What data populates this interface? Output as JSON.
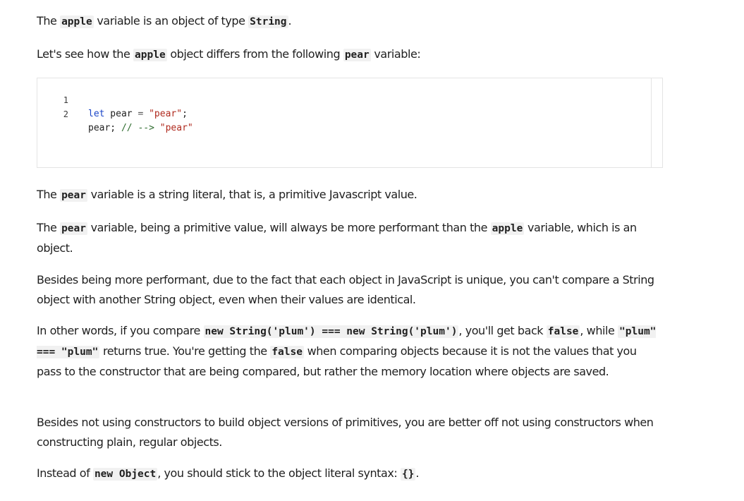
{
  "p1": {
    "t1": "The",
    "c1": "apple",
    "t2": "variable is an object of type",
    "c2": "String",
    "t3": "."
  },
  "p2": {
    "t1": "Let's see how the",
    "c1": "apple",
    "t2": "object differs from the following",
    "c2": "pear",
    "t3": "variable:"
  },
  "code": {
    "lines": [
      {
        "num": "1",
        "kw": "let",
        "ident": " pear ",
        "op": "=",
        "sp": " ",
        "str": "\"pear\"",
        "end": ";"
      },
      {
        "num": "2",
        "ident": "pear;",
        "sp": " ",
        "cmt": "// -->",
        "sp2": " ",
        "str": "\"pear\""
      }
    ]
  },
  "p3": {
    "t1": "The",
    "c1": "pear",
    "t2": "variable is a string literal, that is, a primitive Javascript value."
  },
  "p4": {
    "t1": "The",
    "c1": "pear",
    "t2": "variable, being a primitive value, will always be more performant than the",
    "c2": "apple",
    "t3": "variable, which is an object."
  },
  "p5": {
    "text": "Besides being more performant, due to the fact that each object in JavaScript is unique, you can't compare a String object with another String object, even when their values are identical."
  },
  "p6": {
    "t1": "In other words, if you compare",
    "c1": "new String('plum') === new String('plum')",
    "t2": ", you'll get back",
    "c2": "false",
    "t3": ", while",
    "c3": "\"plum\" === \"plum\"",
    "t4": "returns true. You're getting the",
    "c4": "false",
    "t5": "when comparing objects because it is not the values that you pass to the constructor that are being compared, but rather the memory location where objects are saved."
  },
  "p7": {
    "text": "Besides not using constructors to build object versions of primitives, you are better off not using constructors when constructing plain, regular objects."
  },
  "p8": {
    "t1": "Instead of",
    "c1": "new Object",
    "t2": ", you should stick to the object literal syntax:",
    "c2": "{}",
    "t3": "."
  }
}
